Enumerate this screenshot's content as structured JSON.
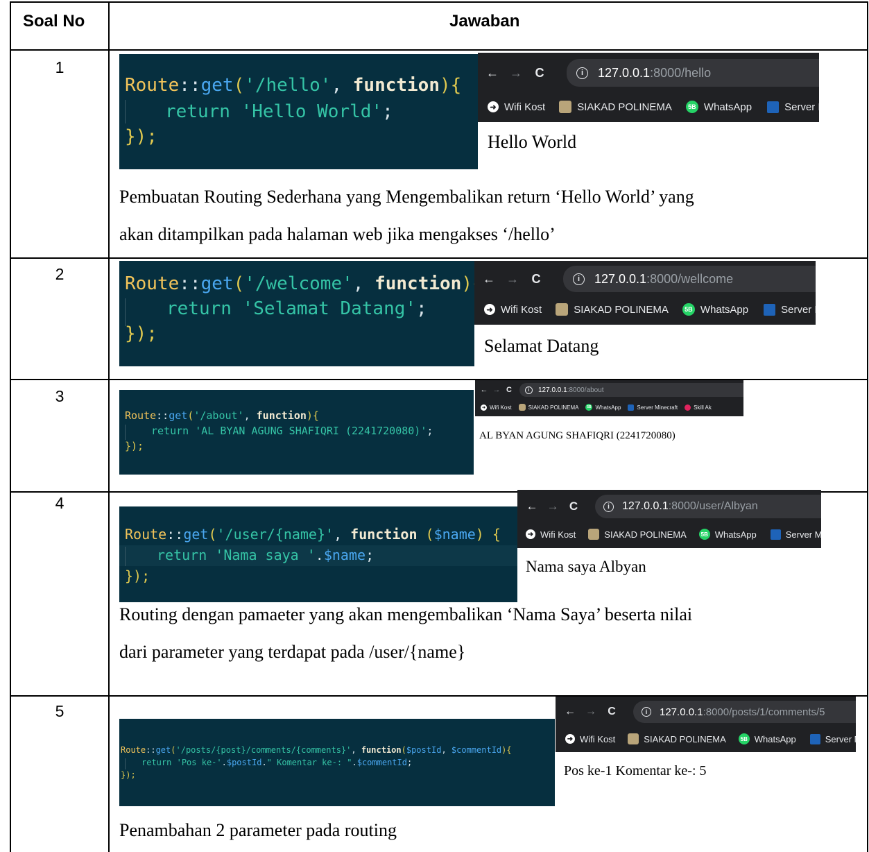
{
  "header": {
    "col1": "Soal No",
    "col2": "Jawaban"
  },
  "rows": [
    {
      "num": "1",
      "code": {
        "path": "'/hello'",
        "ret": "'Hello World'"
      },
      "browser": {
        "host": "127.0.0.1",
        "path": ":8000/hello",
        "output": "Hello World"
      },
      "desc1": "Pembuatan Routing Sederhana yang Mengembalikan return ‘Hello World’ yang",
      "desc2": "akan ditampilkan pada halaman web jika mengakses ‘/hello’"
    },
    {
      "num": "2",
      "code": {
        "path": "'/welcome'",
        "ret": "'Selamat Datang'"
      },
      "browser": {
        "host": "127.0.0.1",
        "path": ":8000/wellcome",
        "output": "Selamat Datang"
      }
    },
    {
      "num": "3",
      "code": {
        "path": "'/about'",
        "ret": "'AL BYAN AGUNG SHAFIQRI (2241720080)'"
      },
      "browser": {
        "host": "127.0.0.1",
        "path": ":8000/about",
        "output": "AL BYAN AGUNG SHAFIQRI (2241720080)"
      }
    },
    {
      "num": "4",
      "code": {
        "path": "'/user/{name}'",
        "param": "$name",
        "ret_str": "'Nama saya '",
        "ret_var": "$name"
      },
      "browser": {
        "host": "127.0.0.1",
        "path": ":8000/user/Albyan",
        "output": "Nama saya Albyan"
      },
      "desc1": "Routing dengan pamaeter yang akan mengembalikan ‘Nama Saya’ beserta nilai",
      "desc2": "dari parameter yang terdapat pada /user/{name}"
    },
    {
      "num": "5",
      "code": {
        "path": "'/posts/{post}/comments/{comments}'",
        "param1": "$postId",
        "param2": "$commentId",
        "s1": "'Pos ke-'",
        "v1": "$postId",
        "s2": "\" Komentar ke-: \"",
        "v2": "$commentId"
      },
      "browser": {
        "host": "127.0.0.1",
        "path": ":8000/posts/1/comments/5",
        "output": "Pos ke-1 Komentar ke-: 5"
      },
      "desc1": "Penambahan 2 parameter pada routing"
    }
  ],
  "code_tokens": {
    "cls": "Route",
    "sep": "::",
    "fn": "get",
    "kw_function": "function",
    "kw_return": "return",
    "open": "(",
    "close": "){",
    "end": "});",
    "comma": ", ",
    "dot": ".",
    "semi": ";"
  },
  "nav": {
    "back": "←",
    "forward": "→",
    "reload": "C",
    "info": "i"
  },
  "bookmarks": {
    "wifi": "Wifi Kost",
    "siakad": "SIAKAD POLINEMA",
    "whatsapp": "WhatsApp",
    "server_min": "Server Min",
    "server_mi": "Server Mi",
    "server_minecraft": "Server Minecraft",
    "skill": "Skill Ak",
    "wa_badge": "5B"
  },
  "colors": {
    "code_bg": "#062f3f",
    "chrome_bg": "#202124",
    "url_bg": "#35363a"
  }
}
